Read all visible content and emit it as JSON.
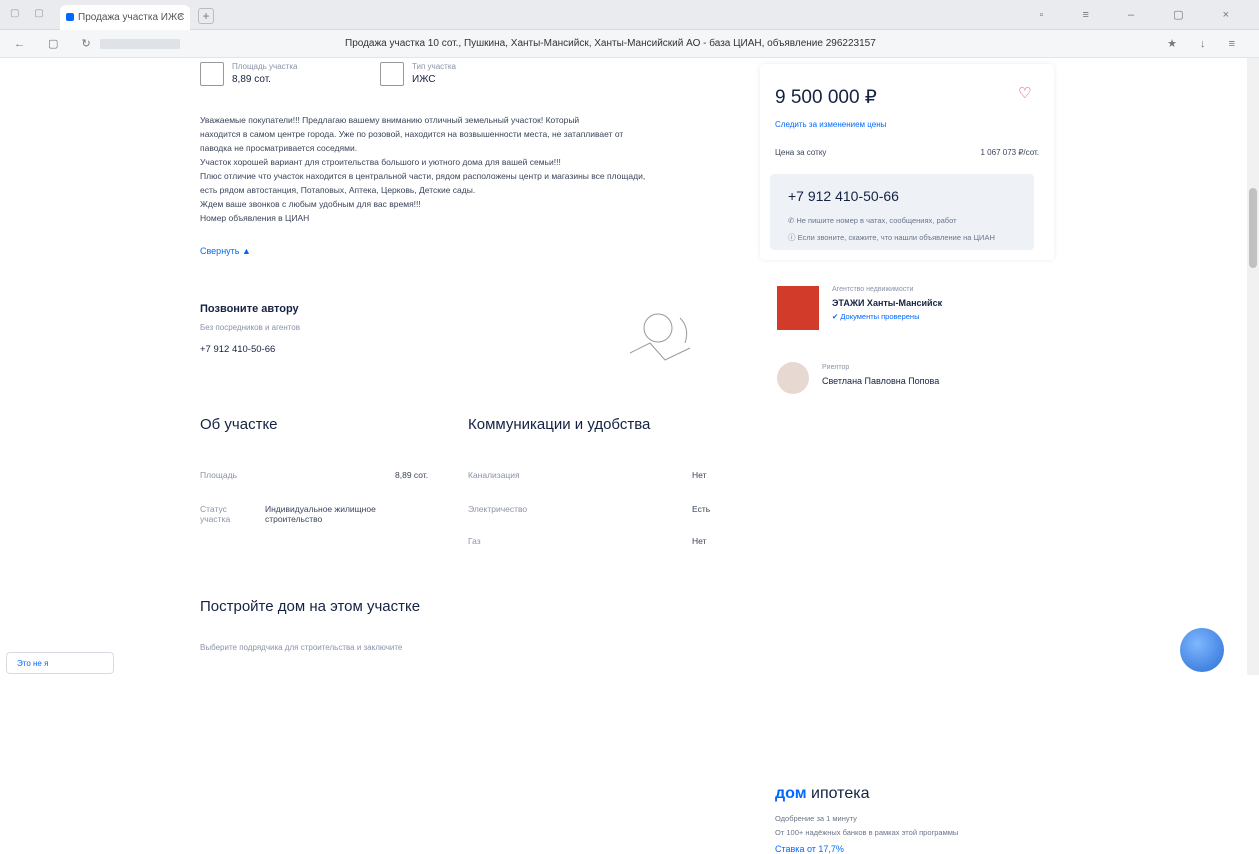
{
  "browser": {
    "tab_title": "Продажа участка ИЖС",
    "page_title": "Продажа участка 10 сот., Пушкина, Ханты-Мансийск, Ханты-Мансийский АО - база ЦИАН, объявление 296223157"
  },
  "specs": [
    {
      "label": "Площадь участка",
      "value": "8,89 сот."
    },
    {
      "label": "Тип участка",
      "value": "ИЖС"
    }
  ],
  "description": {
    "lines": [
      "Уважаемые покупатели!!! Предлагаю вашему вниманию отличный земельный участок! Который",
      "находится в самом центре города. Уже по розовой, находится на возвышенности места, не затапливает от",
      "паводка не просматривается соседями.",
      "Участок хорошей вариант для строительства большого и уютного дома для вашей семьи!!!",
      "Плюс отличие что участок находится в центральной части, рядом расположены центр и магазины все площади,",
      "есть рядом автостанция, Потаповых, Аптека, Церковь, Детские сады.",
      "Ждем ваше звонков с любым удобным для вас время!!!",
      "Номер объявления в ЦИАН"
    ],
    "more_label": "Свернуть"
  },
  "call_author": {
    "title": "Позвоните автору",
    "subtitle": "Без посредников и агентов",
    "phone": "+7 912 410-50-66"
  },
  "about": {
    "title": "Об участке",
    "rows": [
      {
        "label": "Площадь",
        "value": "8,89 сот."
      },
      {
        "label": "Статус участка",
        "value": "Индивидуальное жилищное строительство"
      }
    ]
  },
  "communications": {
    "title": "Коммуникации и удобства",
    "rows": [
      {
        "label": "Канализация",
        "value": "Нет"
      },
      {
        "label": "Электричество",
        "value": "Есть"
      },
      {
        "label": "Газ",
        "value": "Нет"
      }
    ]
  },
  "build": {
    "title": "Постройте дом на этом участке",
    "subtitle": "Выберите подрядчика для строительства и заключите"
  },
  "sidebar": {
    "price": "9 500 000 ₽",
    "follow_link": "Следить за изменением цены",
    "price_per_meter_label": "Цена за сотку",
    "price_per_meter_value": "1 067 073 ₽/сот.",
    "contact_phone": "+7 912 410-50-66",
    "contact_note1": "Не пишите номер в чатах, сообщениях, работ",
    "contact_note2": "Если звоните, скажите, что нашли объявление на ЦИАН",
    "agency_label": "Агентство недвижимости",
    "agency_name": "ЭТАЖИ Ханты-Мансийск",
    "agency_docs": "Документы проверены",
    "agent_label": "Риелтор",
    "agent_name": "Светлана Павловна Попова",
    "mortgage_brand": "дом",
    "mortgage_word": "ипотека",
    "mortgage_line1": "Одобрение за 1 минуту",
    "mortgage_line2": "От 100+ надёжных банков в рамках этой программы",
    "mortgage_rate": "Ставка от 17,7%"
  },
  "bottom_button": "Это не я"
}
